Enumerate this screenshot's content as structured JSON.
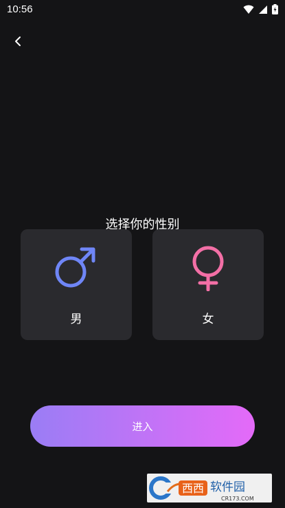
{
  "status_bar": {
    "time": "10:56"
  },
  "header": {
    "back_icon": "chevron-left-icon"
  },
  "main": {
    "title": "选择你的性别",
    "options": [
      {
        "label": "男",
        "icon": "male-icon",
        "color": "#6f86f7"
      },
      {
        "label": "女",
        "icon": "female-icon",
        "color": "#f36fa6"
      }
    ]
  },
  "enter_label": "进入",
  "watermark": {
    "text": "西西软件园",
    "sub": "CR173.COM"
  }
}
